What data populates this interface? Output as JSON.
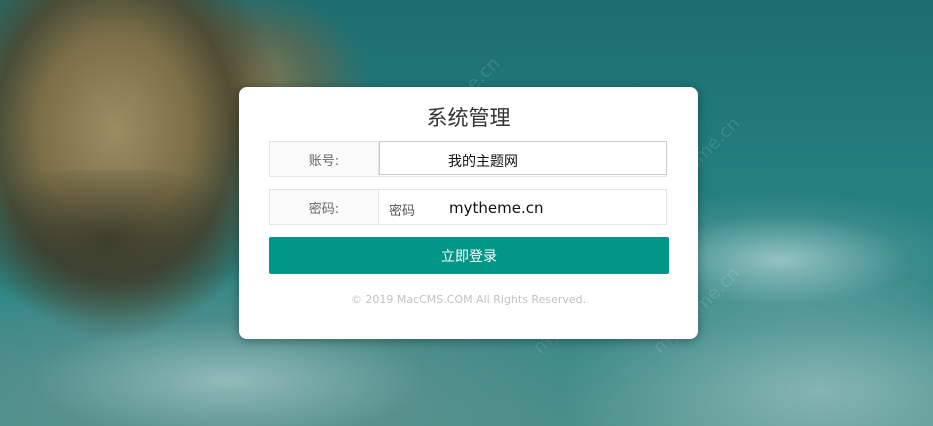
{
  "page": {
    "watermark_text": "mytheme.cn"
  },
  "login": {
    "title": "系统管理",
    "username_label": "账号:",
    "username_value": "我的主题网",
    "password_label": "密码:",
    "password_placeholder": "密码",
    "password_overlay": "mytheme.cn",
    "submit_label": "立即登录",
    "copyright": "© 2019 MacCMS.COM All Rights Reserved."
  },
  "colors": {
    "accent": "#009688",
    "card_bg": "#ffffff",
    "label_bg": "#fafafa"
  }
}
